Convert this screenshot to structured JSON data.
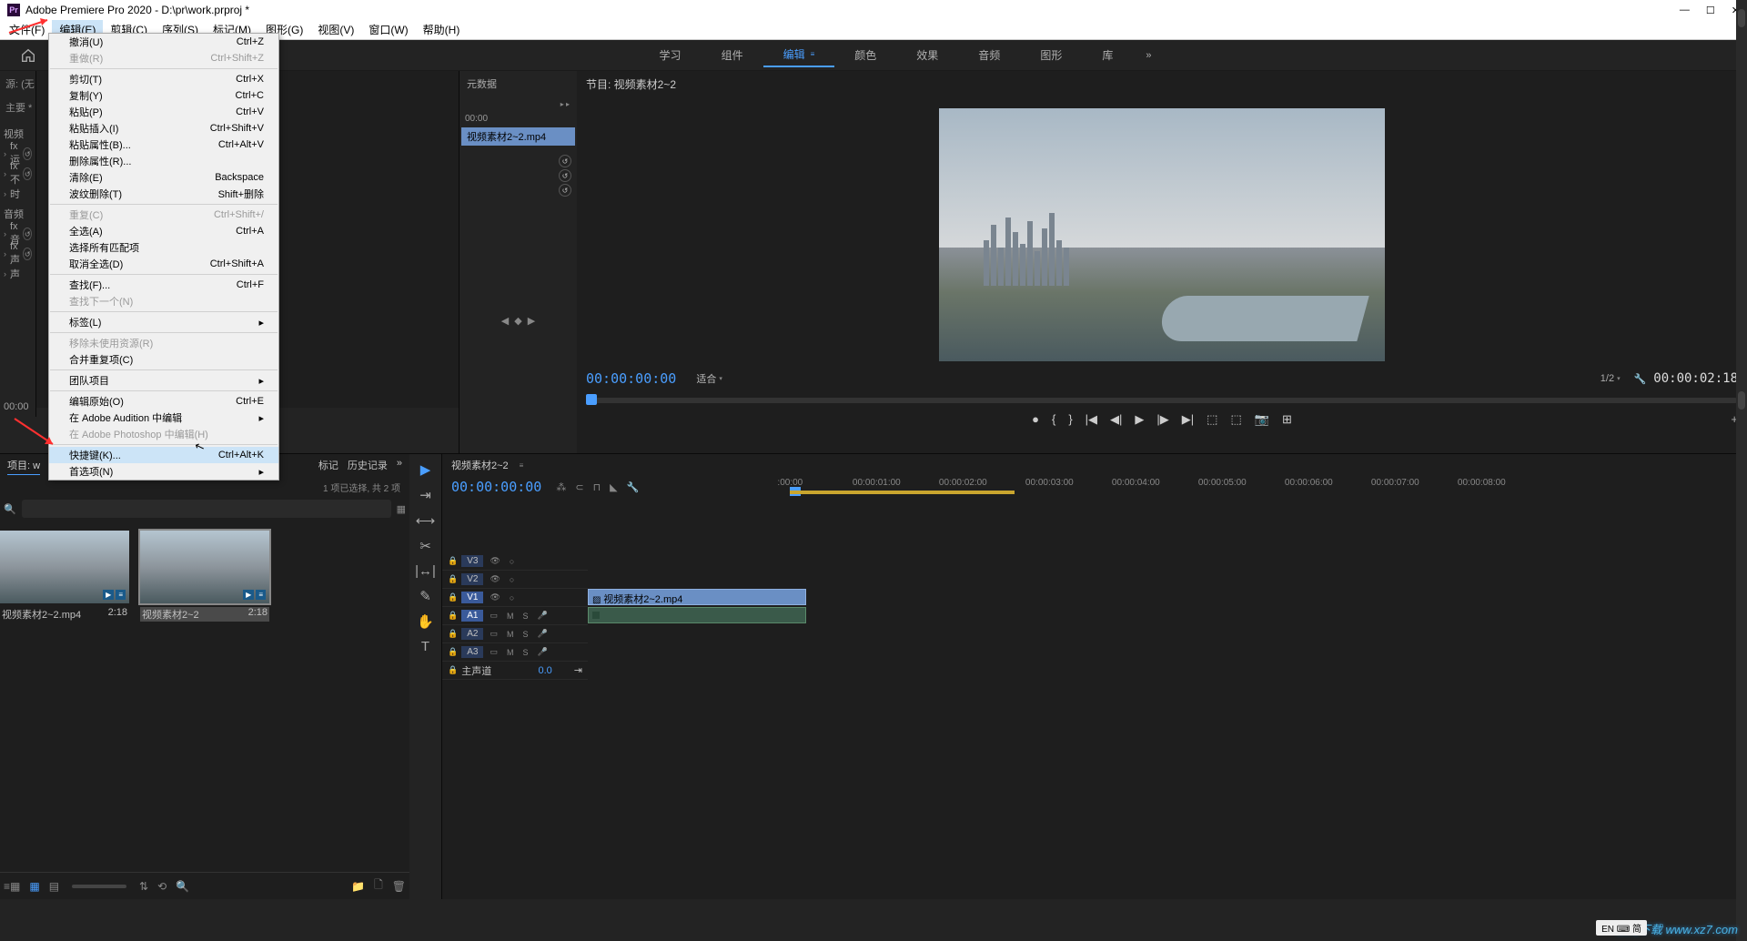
{
  "titlebar": {
    "app_icon_text": "Pr",
    "title": "Adobe Premiere Pro 2020 - D:\\pr\\work.prproj *"
  },
  "menubar": {
    "items": [
      {
        "label": "文件(F)"
      },
      {
        "label": "编辑(E)",
        "active": true
      },
      {
        "label": "剪辑(C)"
      },
      {
        "label": "序列(S)"
      },
      {
        "label": "标记(M)"
      },
      {
        "label": "图形(G)"
      },
      {
        "label": "视图(V)"
      },
      {
        "label": "窗口(W)"
      },
      {
        "label": "帮助(H)"
      }
    ]
  },
  "edit_menu": [
    {
      "label": "撤消(U)",
      "shortcut": "Ctrl+Z"
    },
    {
      "label": "重做(R)",
      "shortcut": "Ctrl+Shift+Z",
      "disabled": true
    },
    {
      "sep": true
    },
    {
      "label": "剪切(T)",
      "shortcut": "Ctrl+X"
    },
    {
      "label": "复制(Y)",
      "shortcut": "Ctrl+C"
    },
    {
      "label": "粘贴(P)",
      "shortcut": "Ctrl+V"
    },
    {
      "label": "粘贴插入(I)",
      "shortcut": "Ctrl+Shift+V"
    },
    {
      "label": "粘贴属性(B)...",
      "shortcut": "Ctrl+Alt+V"
    },
    {
      "label": "删除属性(R)..."
    },
    {
      "label": "清除(E)",
      "shortcut": "Backspace"
    },
    {
      "label": "波纹删除(T)",
      "shortcut": "Shift+删除"
    },
    {
      "sep": true
    },
    {
      "label": "重复(C)",
      "shortcut": "Ctrl+Shift+/",
      "disabled": true
    },
    {
      "label": "全选(A)",
      "shortcut": "Ctrl+A"
    },
    {
      "label": "选择所有匹配项"
    },
    {
      "label": "取消全选(D)",
      "shortcut": "Ctrl+Shift+A"
    },
    {
      "sep": true
    },
    {
      "label": "查找(F)...",
      "shortcut": "Ctrl+F"
    },
    {
      "label": "查找下一个(N)",
      "disabled": true
    },
    {
      "sep": true
    },
    {
      "label": "标签(L)",
      "sub": true
    },
    {
      "sep": true
    },
    {
      "label": "移除未使用资源(R)",
      "disabled": true
    },
    {
      "label": "合并重复项(C)"
    },
    {
      "sep": true
    },
    {
      "label": "团队项目",
      "sub": true
    },
    {
      "sep": true
    },
    {
      "label": "编辑原始(O)",
      "shortcut": "Ctrl+E"
    },
    {
      "label": "在 Adobe Audition 中编辑",
      "sub": true
    },
    {
      "label": "在 Adobe Photoshop 中编辑(H)",
      "disabled": true
    },
    {
      "sep": true
    },
    {
      "label": "快捷键(K)...",
      "shortcut": "Ctrl+Alt+K",
      "highlight": true
    },
    {
      "label": "首选项(N)",
      "sub": true
    }
  ],
  "workspace_tabs": [
    "学习",
    "组件",
    "编辑",
    "颜色",
    "效果",
    "音频",
    "图形",
    "库"
  ],
  "workspace_active_index": 2,
  "effect_panel": {
    "src_label": "源: (无",
    "main_label": "主要 *",
    "video_label": "视频",
    "fx_opacity": "fx 运",
    "fx_label": "fx 不",
    "time_label": "时",
    "audio_label": "音频",
    "fx_vol": "fx 音",
    "fx_ds": "fx 声",
    "panner": "声",
    "tc": "00:00"
  },
  "source_area": {
    "meta_tab": "元数据",
    "timecode": "00:00",
    "clip_name": "视频素材2~2.mp4"
  },
  "program": {
    "title": "节目: 视频素材2~2",
    "tc_left": "00:00:00:00",
    "fit": "适合",
    "res": "1/2",
    "tc_right": "00:00:02:18"
  },
  "project": {
    "tab_proj_label": "项目: w",
    "tab_marker": "标记",
    "tab_history": "历史记录",
    "status": "1 项已选择, 共 2 项",
    "thumbs": [
      {
        "name": "视频素材2~2.mp4",
        "dur": "2:18",
        "sel": false
      },
      {
        "name": "视频素材2~2",
        "dur": "2:18",
        "sel": true
      }
    ]
  },
  "timeline": {
    "seq_name": "视频素材2~2",
    "tc": "00:00:00:00",
    "ticks": [
      ":00:00",
      "00:00:01:00",
      "00:00:02:00",
      "00:00:03:00",
      "00:00:04:00",
      "00:00:05:00",
      "00:00:06:00",
      "00:00:07:00",
      "00:00:08:00"
    ],
    "tracks_v": [
      "V3",
      "V2",
      "V1"
    ],
    "tracks_a": [
      "A1",
      "A2",
      "A3"
    ],
    "master": "主声道",
    "master_val": "0.0",
    "clip_label": "视频素材2~2.mp4"
  },
  "watermark": "极光下载\nwww.xz7.com",
  "ime": "EN ⌨ 简"
}
